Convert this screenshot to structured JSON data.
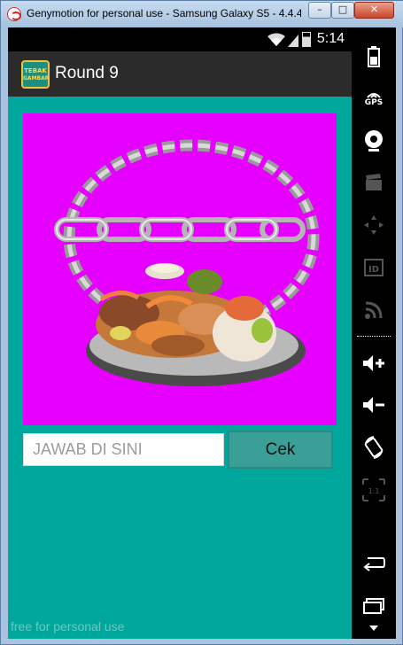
{
  "window": {
    "title": "Genymotion for personal use - Samsung Galaxy S5 - 4.4.4..."
  },
  "statusbar": {
    "time": "5:14"
  },
  "actionbar": {
    "icon_text_top": "TEBAK",
    "icon_text_bottom": "GAMBAR",
    "title": "Round 9"
  },
  "game": {
    "answer_placeholder": "JAWAB DI SINI",
    "check_label": "Cek",
    "picture_bg": "#e600ff",
    "screen_bg": "#00a79d"
  },
  "watermark": "free for personal use",
  "sidebar": {
    "gps_label": "GPS",
    "id_label": "ID",
    "pixel_label": "1:1"
  }
}
